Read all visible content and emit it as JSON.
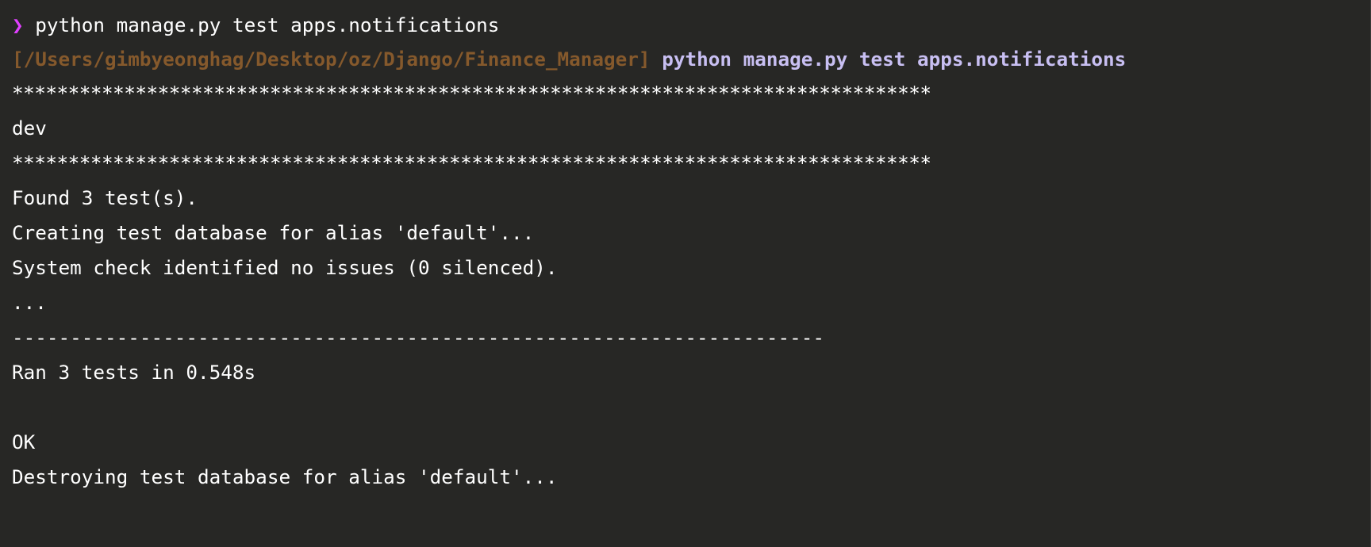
{
  "prompt": {
    "symbol": "❯",
    "command": "python manage.py test apps.notifications"
  },
  "echo": {
    "path": "[/Users/gimbyeonghag/Desktop/oz/Django/Finance_Manager]",
    "command": "python manage.py test apps.notifications"
  },
  "output": {
    "stars_top": "**********************************************************************************",
    "env": "dev",
    "stars_bottom": "**********************************************************************************",
    "found": "Found 3 test(s).",
    "creating": "Creating test database for alias 'default'...",
    "system_check": "System check identified no issues (0 silenced).",
    "dots": "...",
    "separator": "----------------------------------------------------------------------",
    "ran": "Ran 3 tests in 0.548s",
    "ok": "OK",
    "destroying": "Destroying test database for alias 'default'..."
  },
  "colors": {
    "background": "#272725",
    "prompt_symbol": "#e040ff",
    "path": "#85592c",
    "echoed_command": "#c8bff2",
    "text": "#ffffff"
  }
}
